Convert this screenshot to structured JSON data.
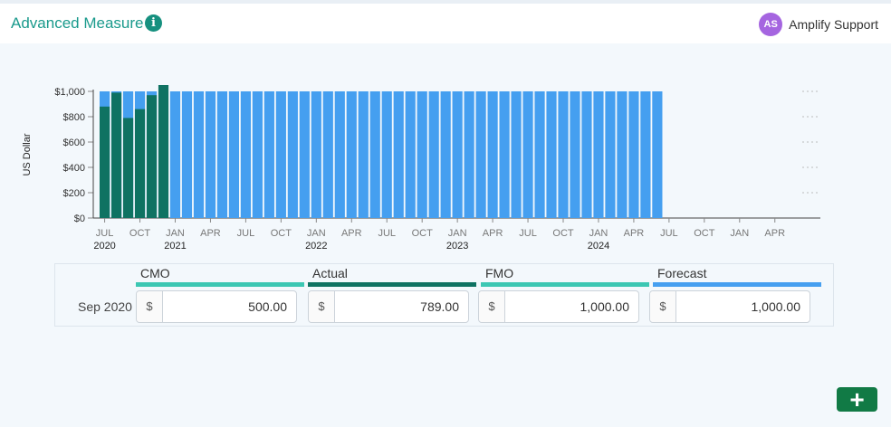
{
  "header": {
    "title": "Advanced Measure",
    "info_icon": "info-icon",
    "user_initials": "AS",
    "user_name": "Amplify Support"
  },
  "colors": {
    "cmo": "#3cc7b3",
    "actual": "#0f7262",
    "fmo": "#3cc7b3",
    "forecast": "#459ff0",
    "accent": "#1a9a8c",
    "add_button": "#117a45"
  },
  "chart_data": {
    "type": "bar",
    "ylabel": "US Dollar",
    "yticks": [
      "$0",
      "$200",
      "$400",
      "$600",
      "$800",
      "$1,000"
    ],
    "ylim": [
      0,
      1000
    ],
    "x_month_ticks": [
      "JUL",
      "OCT",
      "JAN",
      "APR",
      "JUL",
      "OCT",
      "JAN",
      "APR",
      "JUL",
      "OCT",
      "JAN",
      "APR",
      "JUL",
      "OCT",
      "JAN",
      "APR",
      "JUL",
      "OCT",
      "JAN",
      "APR"
    ],
    "x_year_ticks": [
      "2020",
      "2021",
      "2022",
      "2023",
      "2024"
    ],
    "categories": [
      "Jul 2020",
      "Aug 2020",
      "Sep 2020",
      "Oct 2020",
      "Nov 2020",
      "Dec 2020",
      "Jan 2021",
      "Feb 2021",
      "Mar 2021",
      "Apr 2021",
      "May 2021",
      "Jun 2021",
      "Jul 2021",
      "Aug 2021",
      "Sep 2021",
      "Oct 2021",
      "Nov 2021",
      "Dec 2021",
      "Jan 2022",
      "Feb 2022",
      "Mar 2022",
      "Apr 2022",
      "May 2022",
      "Jun 2022",
      "Jul 2022",
      "Aug 2022",
      "Sep 2022",
      "Oct 2022",
      "Nov 2022",
      "Dec 2022",
      "Jan 2023",
      "Feb 2023",
      "Mar 2023",
      "Apr 2023",
      "May 2023",
      "Jun 2023",
      "Jul 2023",
      "Aug 2023",
      "Sep 2023",
      "Oct 2023",
      "Nov 2023",
      "Dec 2023",
      "Jan 2024",
      "Feb 2024",
      "Mar 2024",
      "Apr 2024",
      "May 2024",
      "Jun 2024"
    ],
    "series": [
      {
        "name": "Forecast",
        "values": [
          1000,
          1000,
          1000,
          1000,
          1000,
          1000,
          1000,
          1000,
          1000,
          1000,
          1000,
          1000,
          1000,
          1000,
          1000,
          1000,
          1000,
          1000,
          1000,
          1000,
          1000,
          1000,
          1000,
          1000,
          1000,
          1000,
          1000,
          1000,
          1000,
          1000,
          1000,
          1000,
          1000,
          1000,
          1000,
          1000,
          1000,
          1000,
          1000,
          1000,
          1000,
          1000,
          1000,
          1000,
          1000,
          1000,
          1000,
          1000
        ]
      },
      {
        "name": "Actual",
        "values": [
          880,
          990,
          790,
          860,
          970,
          1050
        ]
      }
    ]
  },
  "panel": {
    "row_label": "Sep 2020",
    "columns": [
      {
        "label": "CMO",
        "prefix": "$",
        "value": "500.00"
      },
      {
        "label": "Actual",
        "prefix": "$",
        "value": "789.00"
      },
      {
        "label": "FMO",
        "prefix": "$",
        "value": "1,000.00"
      },
      {
        "label": "Forecast",
        "prefix": "$",
        "value": "1,000.00"
      }
    ]
  },
  "add_button": {
    "label": "+",
    "icon": "plus-icon"
  }
}
